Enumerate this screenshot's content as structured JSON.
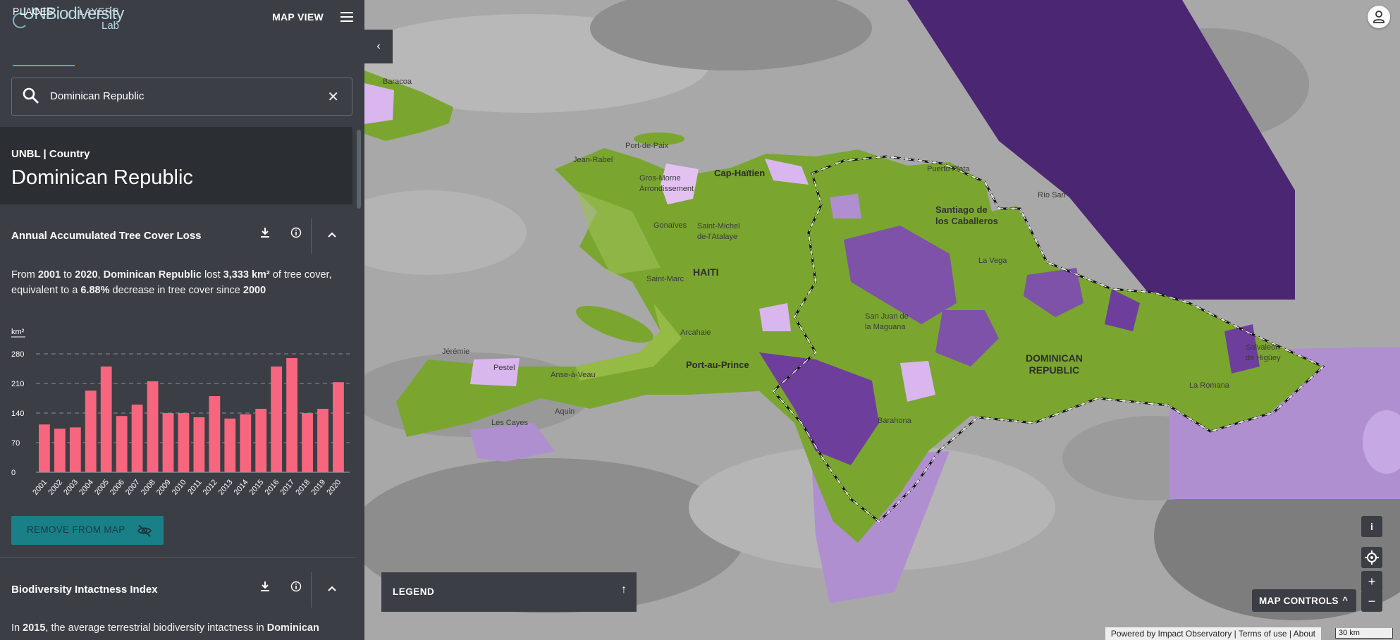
{
  "sidebar": {
    "logo": {
      "main": "UNBiodiversity",
      "sub": "Lab"
    },
    "map_view_label": "MAP VIEW",
    "tabs": {
      "places": "PLACES",
      "layers": "LAYERS"
    },
    "search": {
      "value": "Dominican Republic",
      "clear": "✕"
    },
    "place": {
      "type": "UNBL | Country",
      "name": "Dominican Republic"
    },
    "section1": {
      "title": "Annual Accumulated Tree Cover Loss",
      "text_parts": [
        "From ",
        "2001",
        " to ",
        "2020",
        ", ",
        "Dominican Republic",
        " lost ",
        "3,333 km²",
        " of tree cover, equivalent to a ",
        "6.88%",
        " decrease in tree cover since ",
        "2000"
      ],
      "remove_button": "REMOVE FROM MAP"
    },
    "section2": {
      "title": "Biodiversity Intactness Index",
      "text_parts": [
        "In ",
        "2015",
        ", the average terrestrial biodiversity intactness in ",
        "Dominican"
      ]
    }
  },
  "chart_data": {
    "type": "bar",
    "ylabel": "km²",
    "categories": [
      "2001",
      "2002",
      "2003",
      "2004",
      "2005",
      "2006",
      "2007",
      "2008",
      "2009",
      "2010",
      "2011",
      "2012",
      "2013",
      "2014",
      "2015",
      "2016",
      "2017",
      "2018",
      "2019",
      "2020"
    ],
    "values": [
      113,
      103,
      106,
      193,
      250,
      133,
      160,
      215,
      140,
      140,
      130,
      180,
      127,
      137,
      150,
      250,
      270,
      140,
      150,
      213
    ],
    "yticks": [
      0,
      70,
      140,
      210,
      280
    ],
    "ylim": [
      0,
      280
    ],
    "color": "#f7667e",
    "grid": true
  },
  "map": {
    "collapse_icon": "‹",
    "labels": {
      "baracoa": "Baracoa",
      "port_de_paix": "Port-de-Paix",
      "jean_rabel": "Jean-Rabel",
      "cap_haitien": "Cap-Haïtien",
      "puerto_plata": "Puerto Plata",
      "gros_morne": "Gros-Morne\nArrondissement",
      "gonaives": "Gonaïves",
      "saint_michel": "Saint-Michel\nde-l'Atalaye",
      "santiago": "Santiago de\nlos Caballeros",
      "rio_san": "Río San",
      "haiti": "HAITI",
      "saint_marc": "Saint-Marc",
      "la_vega": "La Vega",
      "arcahaie": "Arcahaie",
      "san_juan": "San Juan de\nla Maguana",
      "port_au_prince": "Port-au-Prince",
      "jeremie": "Jérémie",
      "pestel": "Pestel",
      "anse_a_veau": "Anse-à-Veau",
      "dominican_republic": "DOMINICAN\nREPUBLIC",
      "salvaleon": "Salvaleón\nde Higüey",
      "aquin": "Aquin",
      "les_cayes": "Les Cayes",
      "barahona": "Barahona",
      "la_romana": "La Romana"
    },
    "legend_label": "LEGEND",
    "legend_arrow": "↑",
    "map_controls_label": "MAP CONTROLS",
    "map_controls_caret": "^",
    "info_icon": "i",
    "zoom_in": "+",
    "zoom_out": "−",
    "attribution": {
      "powered": "Powered by Impact Observatory",
      "sep": " | ",
      "terms": "Terms of use",
      "about": "About"
    },
    "scale": "30 km"
  },
  "colors": {
    "sidebar_bg": "#3b3e44",
    "accent": "#5aa9c4",
    "bar": "#f7667e",
    "protected_dark": "#4b2672",
    "protected_light": "#b08fd0",
    "forest": "#7aa630"
  }
}
